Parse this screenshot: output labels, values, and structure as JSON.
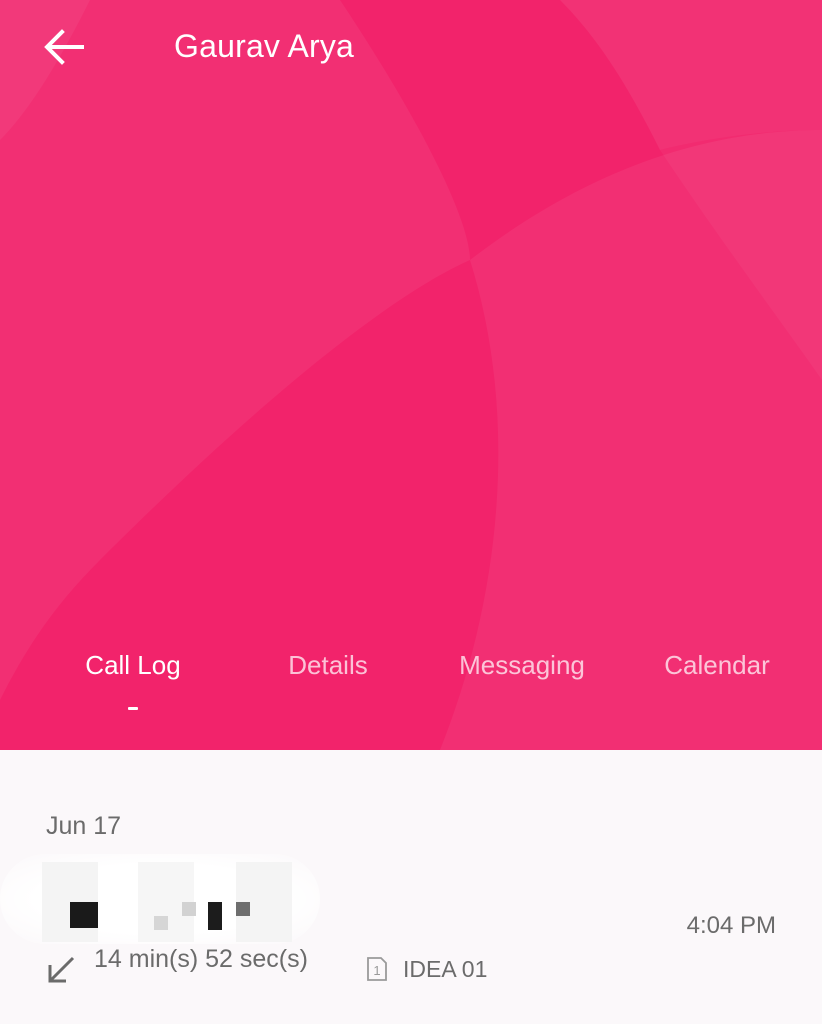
{
  "header": {
    "title": "Gaurav Arya",
    "back_icon": "arrow-left-icon"
  },
  "colors": {
    "accent": "#f2236b",
    "content_bg": "#fbf8fa",
    "secondary_text": "#6b6b6b"
  },
  "tabs": [
    {
      "label": "Call Log",
      "active": true
    },
    {
      "label": "Details",
      "active": false
    },
    {
      "label": "Messaging",
      "active": false
    },
    {
      "label": "Calendar",
      "active": false
    }
  ],
  "call_log": {
    "date": "Jun 17",
    "entries": [
      {
        "time": "4:04 PM",
        "duration": "14 min(s) 52 sec(s)",
        "sim": "IDEA 01",
        "sim_slot": "1",
        "direction_icon": "incoming-call-arrow-icon",
        "sim_icon": "sim-card-icon"
      }
    ]
  }
}
